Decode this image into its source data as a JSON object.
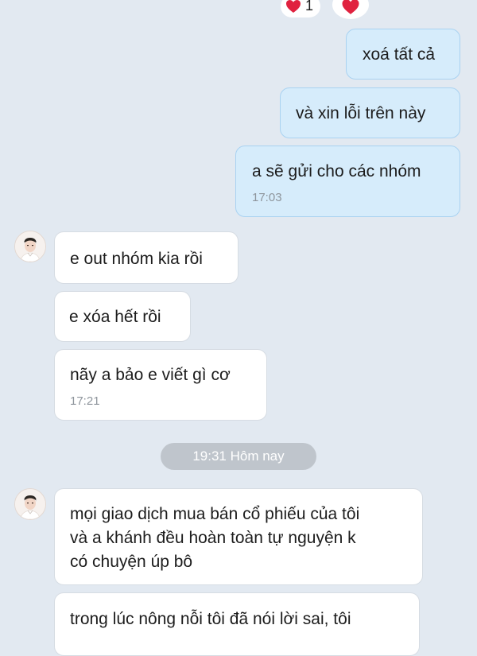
{
  "theme": {
    "background": "#e2e9f1",
    "outgoing_bubble": "#d6ecfb",
    "incoming_bubble": "#ffffff",
    "heart_color": "#e0223f"
  },
  "top_reactions": {
    "count": "1",
    "icon": "heart-icon"
  },
  "messages": [
    {
      "direction": "outgoing",
      "text": "xoá tất cả"
    },
    {
      "direction": "outgoing",
      "text": "và xin lỗi trên này"
    },
    {
      "direction": "outgoing",
      "text": "a sẽ gửi cho các nhóm",
      "time": "17:03"
    },
    {
      "direction": "incoming",
      "text": "e out nhóm kia rồi"
    },
    {
      "direction": "incoming",
      "text": "e xóa hết rồi"
    },
    {
      "direction": "incoming",
      "text": "nãy a bảo e viết gì cơ",
      "time": "17:21"
    },
    {
      "direction": "incoming",
      "lines": [
        "mọi giao dịch mua bán cổ phiếu của tôi",
        "và a khánh đều hoàn toàn tự nguyện k",
        "có chuyện úp bô"
      ]
    },
    {
      "direction": "incoming",
      "lines": [
        "trong lúc nông nỗi tôi đã nói lời sai, tôi"
      ]
    }
  ],
  "date_divider": "19:31 Hôm nay"
}
